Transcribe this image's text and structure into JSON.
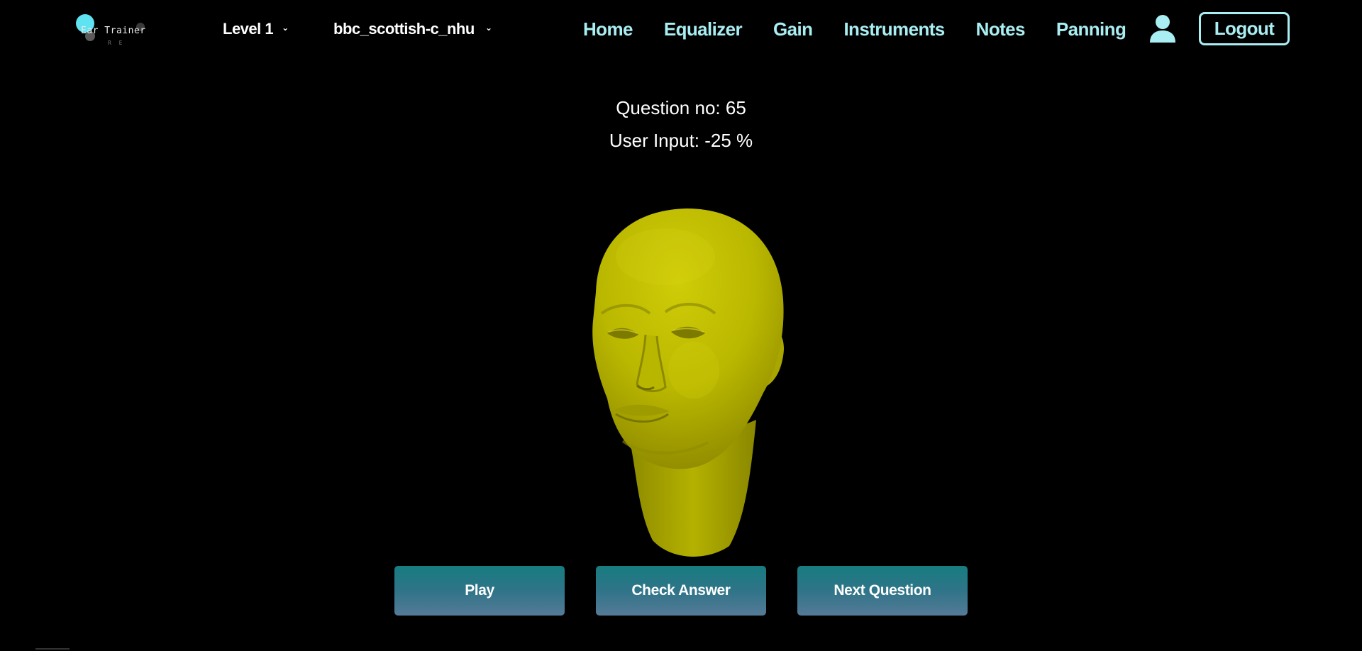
{
  "logo": {
    "text": "Ear Trainer",
    "subtext": "R E"
  },
  "selectors": {
    "level": "Level 1",
    "instrument": "bbc_scottish-c_nhu"
  },
  "nav": {
    "items": [
      {
        "label": "Home"
      },
      {
        "label": "Equalizer"
      },
      {
        "label": "Gain"
      },
      {
        "label": "Instruments"
      },
      {
        "label": "Notes"
      },
      {
        "label": "Panning"
      }
    ],
    "logout_label": "Logout",
    "user_icon": "user-icon"
  },
  "quiz": {
    "question_label": "Question no: 65",
    "user_input_label": "User Input: -25 %"
  },
  "actions": {
    "play_label": "Play",
    "check_label": "Check Answer",
    "next_label": "Next Question"
  },
  "colors": {
    "background": "#000000",
    "nav_accent": "#a9eef2",
    "logo_dot": "#5fe3f0",
    "head_model": "#c4c200",
    "button_top": "#177c80",
    "button_bottom": "#557a97"
  }
}
